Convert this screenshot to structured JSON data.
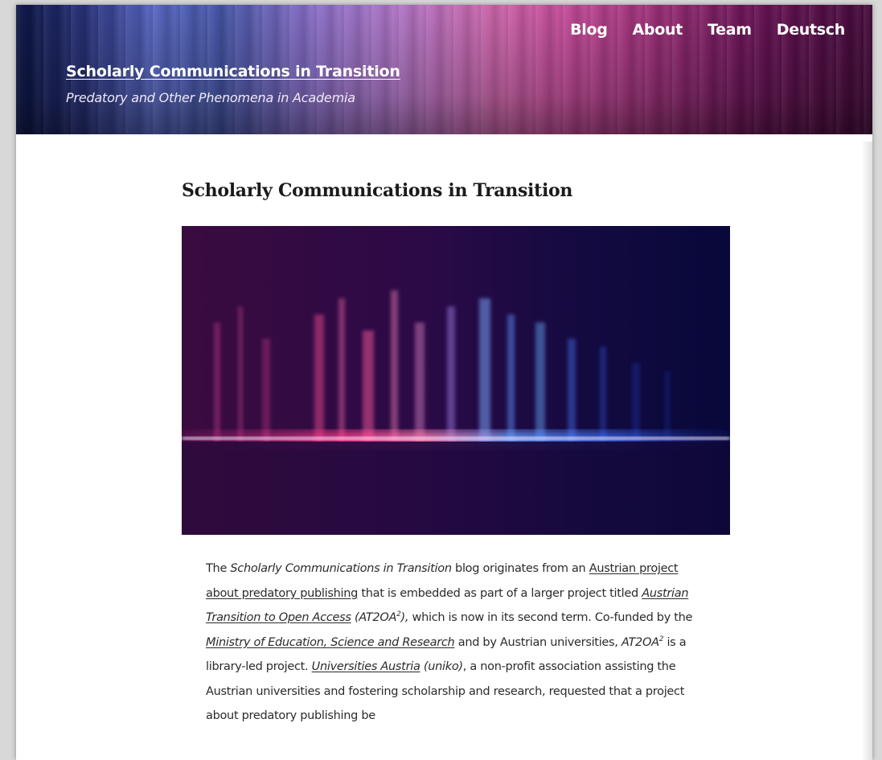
{
  "site": {
    "title": "Scholarly Communications in Transition",
    "description": "Predatory and Other Phenomena in Academia"
  },
  "nav": {
    "items": [
      {
        "label": "Blog"
      },
      {
        "label": "About"
      },
      {
        "label": "Team"
      },
      {
        "label": "Deutsch"
      }
    ]
  },
  "page": {
    "title": "Scholarly Communications in Transition"
  },
  "body": {
    "p1": {
      "t1": "The ",
      "blog_name": "Scholarly Communications in Transition",
      "t2": " blog originates from an ",
      "link_project": "Austrian project about predatory publishing",
      "t3": " that is embedded as part of a larger project titled ",
      "link_at2oa": "Austrian Transition to Open Access",
      "t4_open": " (AT2OA",
      "sup1": "2",
      "t4_close": "),",
      "t5": " which is now in its second term. Co-funded by the ",
      "link_ministry": "Ministry of Education, Science and Research",
      "t6": " and by Austrian universities, ",
      "abbr2": "AT2OA",
      "sup2": "2",
      "t7": " is a library-led project. ",
      "link_uniko": "Universities Austria",
      "uniko_abbr": " (uniko)",
      "t8": ", a non-profit association assisting the Austrian universities and fostering scholarship and research, requested that a project about predatory publishing be"
    }
  },
  "colors": {
    "header_left": "#0a1446",
    "header_right": "#460a3c",
    "text": "#2b2b2b",
    "title": "#1a1a1a"
  }
}
